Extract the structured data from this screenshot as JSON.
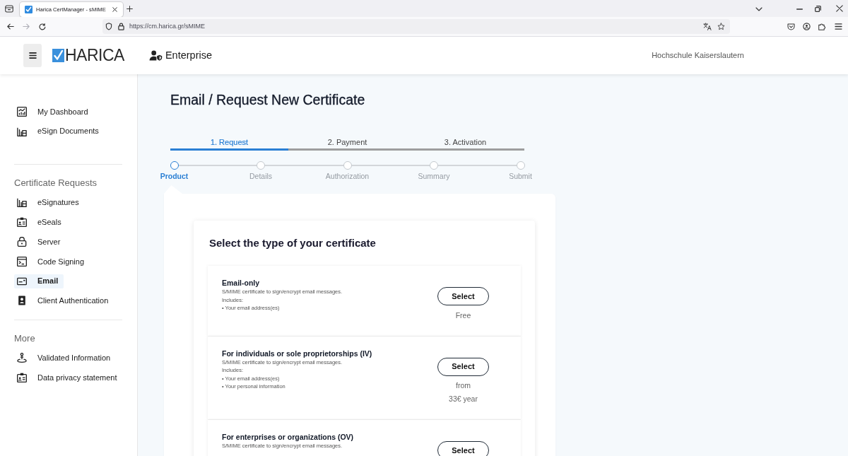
{
  "browser": {
    "tab_title": "Harica CertManager - sMIME",
    "address": "https://cm.harica.gr/sMIME",
    "forward_disabled": true
  },
  "header": {
    "brand": "HARICA",
    "portal": "Enterprise",
    "organization": "Hochschule Kaiserslautern"
  },
  "sidebar": {
    "sections": [
      {
        "items": [
          {
            "label": "My Dashboard",
            "selected": false
          },
          {
            "label": "eSign Documents",
            "selected": false
          }
        ]
      },
      {
        "heading": "Certificate Requests",
        "items": [
          {
            "label": "eSignatures",
            "selected": false
          },
          {
            "label": "eSeals",
            "selected": false
          },
          {
            "label": "Server",
            "selected": false
          },
          {
            "label": "Code Signing",
            "selected": false
          },
          {
            "label": "Email",
            "selected": true
          },
          {
            "label": "Client Authentication",
            "selected": false
          }
        ]
      },
      {
        "heading": "More",
        "items": [
          {
            "label": "Validated Information",
            "selected": false
          },
          {
            "label": "Data privacy statement",
            "selected": false
          }
        ]
      }
    ]
  },
  "page": {
    "title": "Email / Request New Certificate"
  },
  "stepper": {
    "phases": [
      {
        "label": "1. Request",
        "selected": true
      },
      {
        "label": "2. Payment",
        "selected": false
      },
      {
        "label": "3. Activation",
        "selected": false
      }
    ],
    "steps": [
      {
        "label": "Product",
        "selected": true
      },
      {
        "label": "Details",
        "selected": false
      },
      {
        "label": "Authorization",
        "selected": false
      },
      {
        "label": "Summary",
        "selected": false
      },
      {
        "label": "Submit",
        "selected": false
      }
    ]
  },
  "certificate_selection": {
    "heading": "Select the type of your certificate",
    "options": [
      {
        "title": "Email-only",
        "description": "S/MIME certificate to sign/encrypt email messages.",
        "includes_label": "Includes:",
        "includes": [
          "• Your email address(es)"
        ],
        "button": "Select",
        "price": [
          "Free"
        ]
      },
      {
        "title": "For individuals or sole proprietorships (IV)",
        "description": "S/MIME certificate to sign/encrypt email messages.",
        "includes_label": "Includes:",
        "includes": [
          "• Your email address(es)",
          "• Your personal information"
        ],
        "button": "Select",
        "price": [
          "from",
          "33€ year"
        ]
      },
      {
        "title": "For enterprises or organizations (OV)",
        "description": "S/MIME certificate to sign/encrypt email messages.",
        "button": "Select"
      }
    ]
  }
}
